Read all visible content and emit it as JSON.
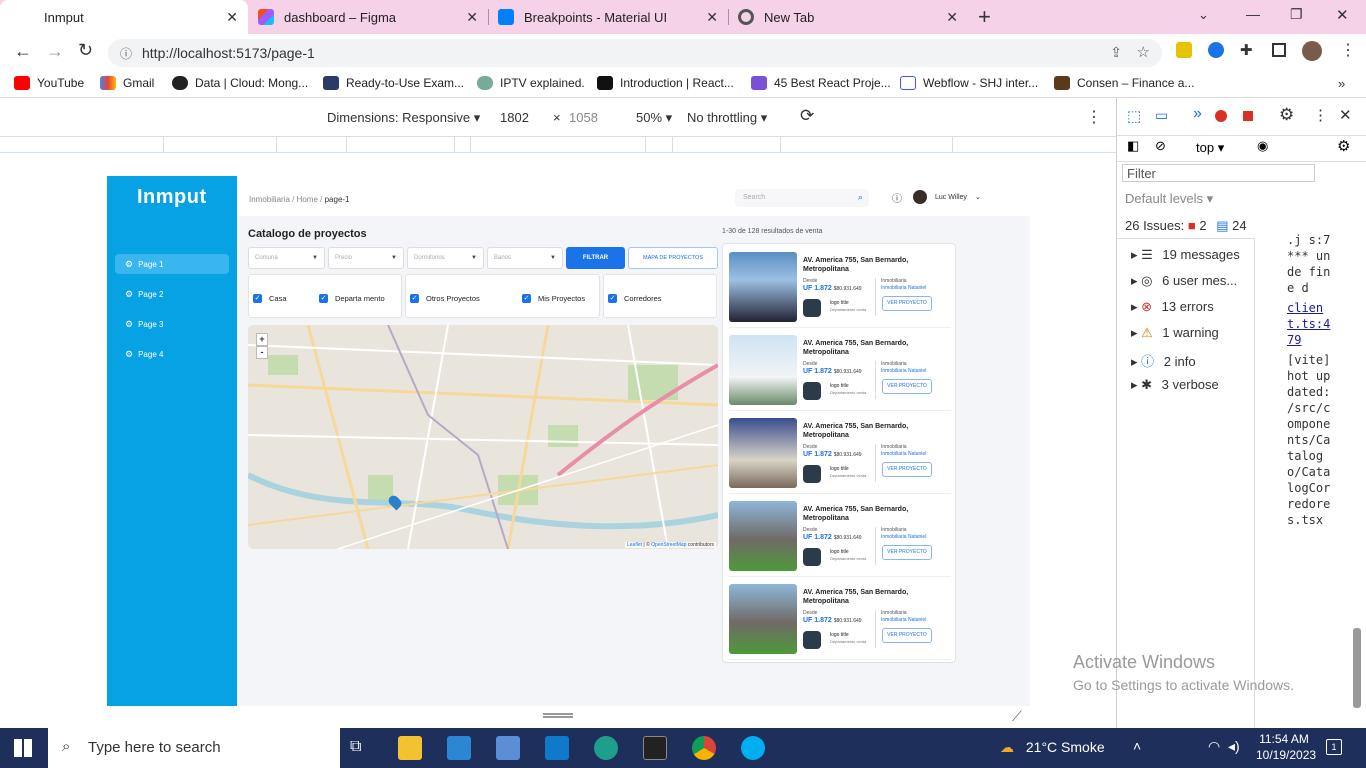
{
  "browser": {
    "tabs": [
      {
        "title": "Inmput",
        "active": true
      },
      {
        "title": "dashboard – Figma",
        "active": false
      },
      {
        "title": "Breakpoints - Material UI",
        "active": false
      },
      {
        "title": "New Tab",
        "active": false
      }
    ],
    "url": "http://localhost:5173/page-1",
    "bookmarks": [
      "YouTube",
      "Gmail",
      "Data | Cloud: Mong...",
      "Ready-to-Use Exam...",
      "IPTV explained.",
      "Introduction | React...",
      "45 Best React Proje...",
      "Webflow - SHJ inter...",
      "Consen – Finance a..."
    ]
  },
  "device_toolbar": {
    "dimensions_label": "Dimensions: Responsive",
    "width": "1802",
    "height": "1058",
    "zoom": "50%",
    "throttling": "No throttling"
  },
  "app": {
    "logo": "Inmput",
    "nav": [
      "Page 1",
      "Page 2",
      "Page 3",
      "Page 4"
    ],
    "breadcrumb": "Inmobiliaria / Home /",
    "breadcrumb_current": "page-1",
    "search_placeholder": "Search",
    "user_name": "Luc Willey",
    "page_title": "Catalogo de proyectos",
    "results_text": "1-30 de 128 resultados de venta",
    "filters": {
      "selects": [
        "Comuna",
        "Precio",
        "Dormitorios",
        "Banos"
      ],
      "filter_button": "FILTRAR",
      "map_button": "MAPA DE PROYECTOS"
    },
    "checkboxes": [
      "Casa",
      "Departa mento",
      "Otros Proyectos",
      "Mis Proyectos",
      "Corredores"
    ],
    "map": {
      "zoom_in": "+",
      "zoom_out": "-",
      "attribution_leaflet": "Leaflet",
      "attribution_sep": " | © ",
      "attribution_osm": "OpenStreetMap",
      "attribution_suffix": " contributors"
    },
    "listings": [
      {
        "address": "AV. America 755, San Bernardo, Metropolitana",
        "desde": "Desde",
        "price": "UF 1.872",
        "price_clp": "$80.931.649",
        "logo_title": "logo title",
        "dept": "Departamento venta",
        "inm_label": "Inmobiliaria",
        "inm_name": "Inmobiliaria Nataniel",
        "button": "VER PROYECTO"
      },
      {
        "address": "AV. America 755, San Bernardo, Metropolitana",
        "desde": "Desde",
        "price": "UF 1.872",
        "price_clp": "$80.931.649",
        "logo_title": "logo title",
        "dept": "Departamento venta",
        "inm_label": "Inmobiliaria",
        "inm_name": "Inmobiliaria Nataniel",
        "button": "VER PROYECTO"
      },
      {
        "address": "AV. America 755, San Bernardo, Metropolitana",
        "desde": "Desde",
        "price": "UF 1.872",
        "price_clp": "$80.931.649",
        "logo_title": "logo title",
        "dept": "Departamento venta",
        "inm_label": "Inmobiliaria",
        "inm_name": "Inmobiliaria Nataniel",
        "button": "VER PROYECTO"
      },
      {
        "address": "AV. America 755, San Bernardo, Metropolitana",
        "desde": "Desde",
        "price": "UF 1.872",
        "price_clp": "$80.931.649",
        "logo_title": "logo title",
        "dept": "Departamento venta",
        "inm_label": "Inmobiliaria",
        "inm_name": "Inmobiliaria Nataniel",
        "button": "VER PROYECTO"
      },
      {
        "address": "AV. America 755, San Bernardo, Metropolitana",
        "desde": "Desde",
        "price": "UF 1.872",
        "price_clp": "$80.931.649",
        "logo_title": "logo title",
        "dept": "Departamento venta",
        "inm_label": "Inmobiliaria",
        "inm_name": "Inmobiliaria Nataniel",
        "button": "VER PROYECTO"
      }
    ]
  },
  "devtools": {
    "context": "top",
    "filter_placeholder": "Filter",
    "levels": "Default levels",
    "issues_label": "26 Issues:",
    "issues_errors": "2",
    "issues_info": "24",
    "groups": [
      "19 messages",
      "6 user mes...",
      "13 errors",
      "1 warning",
      "2 info",
      "3 verbose"
    ],
    "log_text": ".j s:7 *** unde fine d",
    "link_file": "client.ts:479",
    "log_vite": "[vite] hot updated: /src/components/Catalogo/CatalogCorredores.tsx"
  },
  "watermark": {
    "line1": "Activate Windows",
    "line2": "Go to Settings to activate Windows."
  },
  "taskbar": {
    "search_placeholder": "Type here to search",
    "weather": "21°C  Smoke",
    "time": "11:54 AM",
    "date": "10/19/2023",
    "notifications": "1"
  },
  "colors": {
    "sidebar": "#06a2e3",
    "primary": "#1a73e8",
    "tab_strip": "#f5d2e7",
    "taskbar": "#1f2f5b"
  }
}
